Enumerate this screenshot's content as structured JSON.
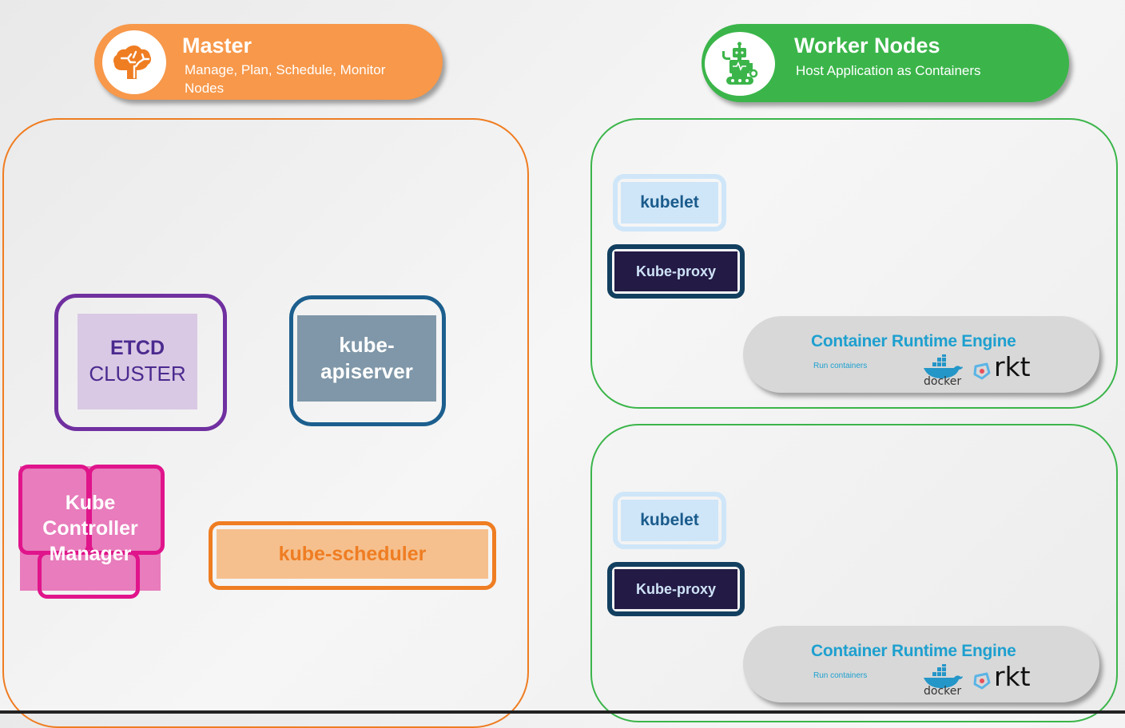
{
  "header": {
    "master": {
      "title": "Master",
      "subtitle": "Manage, Plan, Schedule, Monitor Nodes",
      "icon": "brain-icon",
      "color": "#f7984a"
    },
    "workers": {
      "title": "Worker Nodes",
      "subtitle": "Host Application as Containers",
      "icon": "robot-icon",
      "color": "#3bb54a"
    }
  },
  "master_components": {
    "etcd": {
      "line1": "ETCD",
      "line2": "CLUSTER"
    },
    "apiserver": {
      "label": "kube-apiserver",
      "line1": "kube-",
      "line2": "apiserver"
    },
    "controller_manager": {
      "label": "Kube Controller Manager"
    },
    "scheduler": {
      "label": "kube-scheduler"
    }
  },
  "worker_nodes": [
    {
      "kubelet": "kubelet",
      "kube_proxy": "Kube-proxy",
      "runtime": {
        "title": "Container Runtime Engine",
        "subtitle": "Run containers",
        "logos": [
          "docker",
          "rkt"
        ]
      }
    },
    {
      "kubelet": "kubelet",
      "kube_proxy": "Kube-proxy",
      "runtime": {
        "title": "Container Runtime Engine",
        "subtitle": "Run containers",
        "logos": [
          "docker",
          "rkt"
        ]
      }
    }
  ],
  "colors": {
    "master_border": "#ef7d22",
    "worker_border": "#3bb54a",
    "etcd": "#7030a0",
    "apiserver": "#1c5f8e",
    "controller_manager": "#e0148b",
    "scheduler": "#ef7d22",
    "runtime_text": "#1ea0cf"
  }
}
